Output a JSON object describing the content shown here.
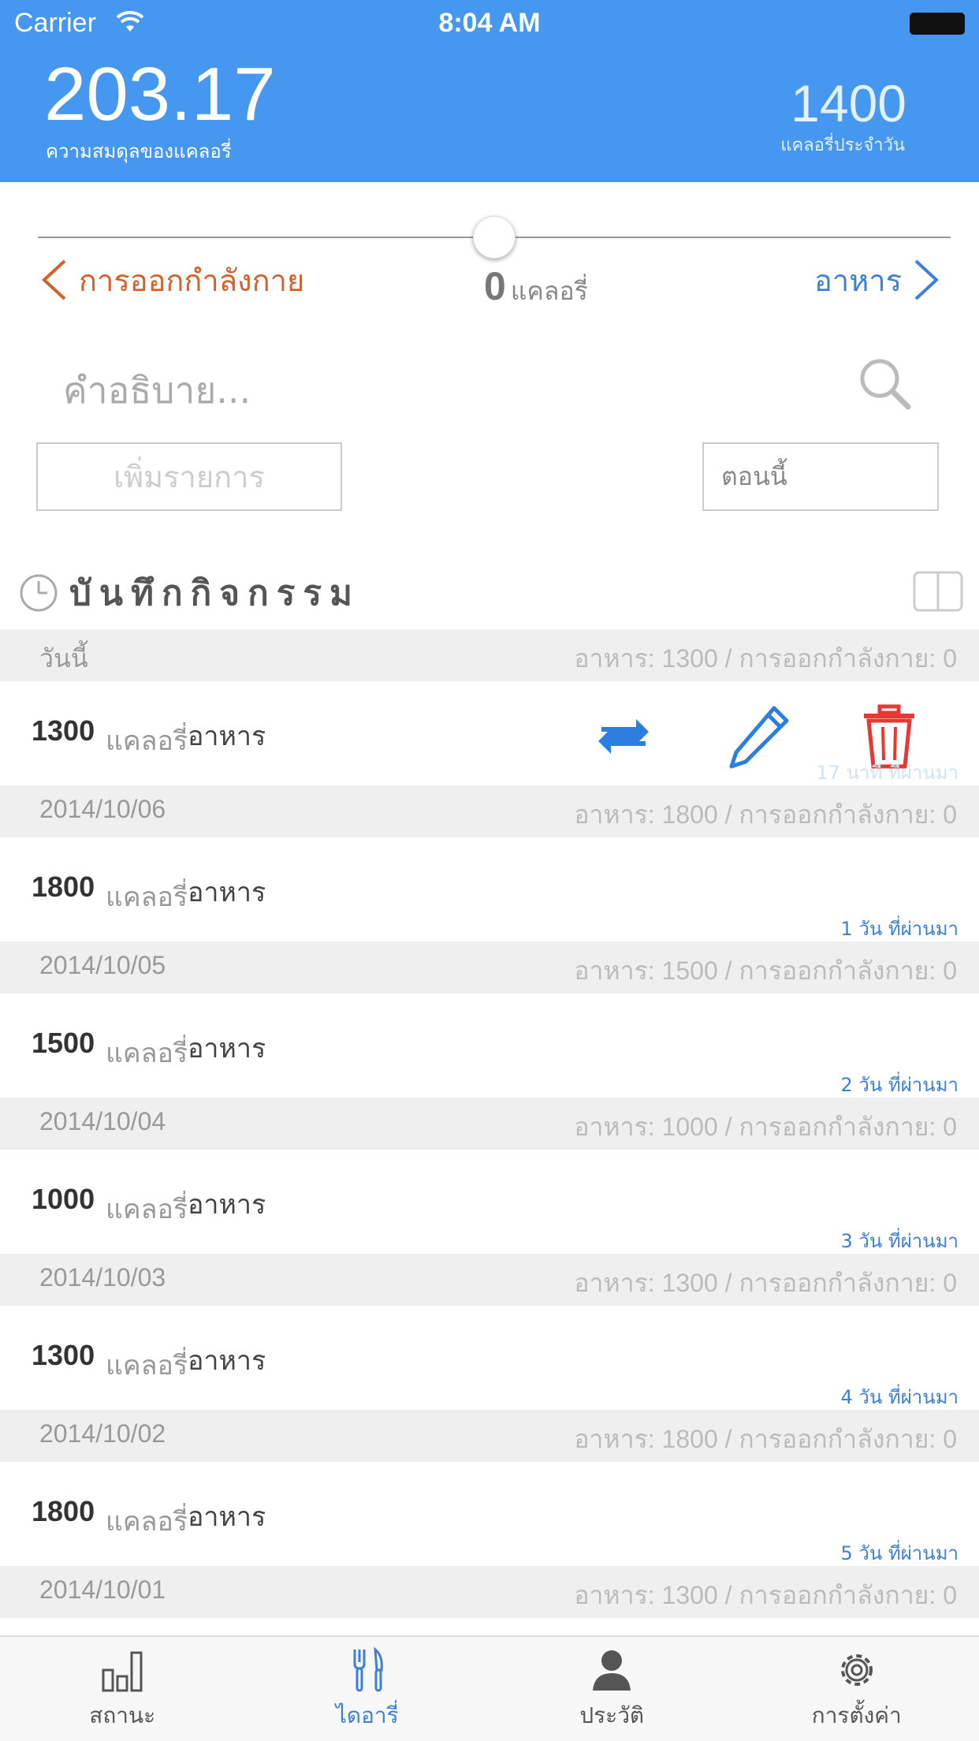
{
  "status_bar": {
    "carrier": "Carrier",
    "time": "8:04 AM"
  },
  "header": {
    "balance_value": "203.17",
    "balance_label": "ความสมดุลของแคลอรี่",
    "daily_value": "1400",
    "daily_label": "แคลอรี่ประจำวัน",
    "accent_color": "#4597ef"
  },
  "slider": {
    "left_label": "การออกกำลังกาย",
    "right_label": "อาหาร",
    "calories_value": "0",
    "calories_unit": "แคลอรี่",
    "level": 0.5
  },
  "form": {
    "description_placeholder": "คำอธิบาย...",
    "add_button": "เพิ่มรายการ",
    "time_button": "ตอนนี้"
  },
  "log": {
    "title": "บันทึกกิจกรรม",
    "days": [
      {
        "date": "วันนี้",
        "summary": "อาหาร: 1300 / การออกกำลังกาย: 0",
        "entry": {
          "calories": "1300",
          "unit": "แคลอรี่",
          "type": "อาหาร",
          "ago": "17 นาที ที่ผ่านมา"
        }
      },
      {
        "date": "2014/10/06",
        "summary": "อาหาร: 1800 / การออกกำลังกาย: 0",
        "entry": {
          "calories": "1800",
          "unit": "แคลอรี่",
          "type": "อาหาร",
          "ago": "1 วัน ที่ผ่านมา"
        }
      },
      {
        "date": "2014/10/05",
        "summary": "อาหาร: 1500 / การออกกำลังกาย: 0",
        "entry": {
          "calories": "1500",
          "unit": "แคลอรี่",
          "type": "อาหาร",
          "ago": "2 วัน ที่ผ่านมา"
        }
      },
      {
        "date": "2014/10/04",
        "summary": "อาหาร: 1000 / การออกกำลังกาย: 0",
        "entry": {
          "calories": "1000",
          "unit": "แคลอรี่",
          "type": "อาหาร",
          "ago": "3 วัน ที่ผ่านมา"
        }
      },
      {
        "date": "2014/10/03",
        "summary": "อาหาร: 1300 / การออกกำลังกาย: 0",
        "entry": {
          "calories": "1300",
          "unit": "แคลอรี่",
          "type": "อาหาร",
          "ago": "4 วัน ที่ผ่านมา"
        }
      },
      {
        "date": "2014/10/02",
        "summary": "อาหาร: 1800 / การออกกำลังกาย: 0",
        "entry": {
          "calories": "1800",
          "unit": "แคลอรี่",
          "type": "อาหาร",
          "ago": "5 วัน ที่ผ่านมา"
        }
      },
      {
        "date": "2014/10/01",
        "summary": "อาหาร: 1300 / การออกกำลังกาย: 0"
      }
    ]
  },
  "tabs": [
    {
      "label": "สถานะ",
      "icon": "bar-chart-icon"
    },
    {
      "label": "ไดอารี่",
      "icon": "fork-knife-icon",
      "active": true
    },
    {
      "label": "ประวัติ",
      "icon": "person-icon"
    },
    {
      "label": "การตั้งค่า",
      "icon": "gear-icon"
    }
  ]
}
